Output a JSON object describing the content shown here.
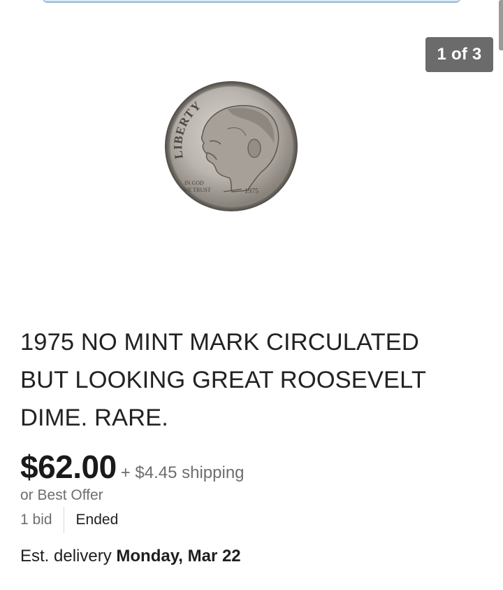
{
  "gallery": {
    "counter": "1 of 3"
  },
  "coin": {
    "legend_top": "LIBERTY",
    "motto_1": "IN GOD",
    "motto_2": "WE TRUST",
    "year": "1975"
  },
  "listing": {
    "title": "1975 NO MINT MARK CIRCULATED BUT LOOKING GREAT ROOSEVELT DIME. RARE.",
    "price": "$62.00",
    "shipping": "+ $4.45 shipping",
    "best_offer": "or Best Offer",
    "bids": "1 bid",
    "status": "Ended",
    "delivery_label": "Est. delivery",
    "delivery_date": "Monday, Mar 22"
  },
  "colors": {
    "counter_bg": "#6b6b6b",
    "text_primary": "#1f1f1f",
    "text_secondary": "#6e6e6e",
    "coin_silver": "#b9b4ad"
  }
}
